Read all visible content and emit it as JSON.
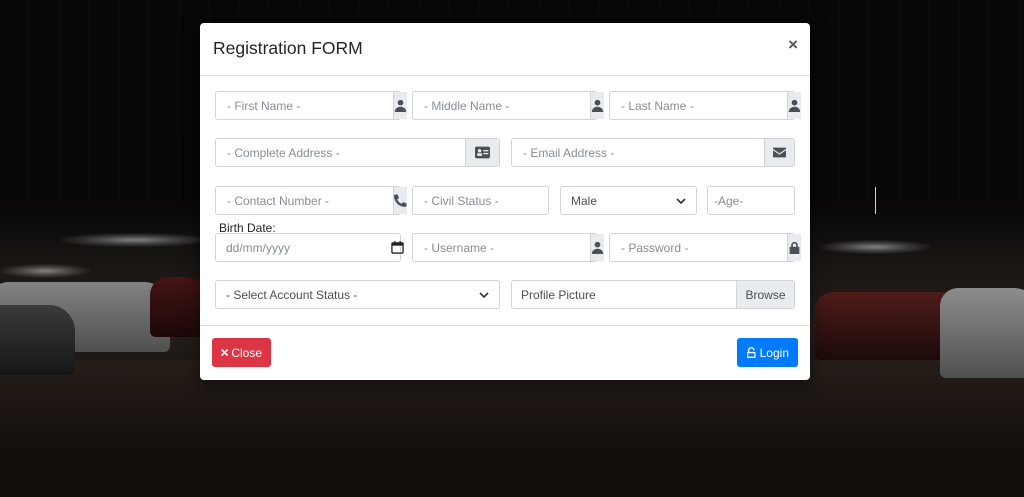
{
  "modal": {
    "title": "Registration FORM",
    "close_symbol": "×"
  },
  "fields": {
    "first_name": {
      "placeholder": "- First Name -",
      "icon": "user-icon"
    },
    "middle_name": {
      "placeholder": "- Middle Name -",
      "icon": "user-icon"
    },
    "last_name": {
      "placeholder": "- Last Name -",
      "icon": "user-icon"
    },
    "address": {
      "placeholder": "- Complete Address -",
      "icon": "address-card-icon"
    },
    "email": {
      "placeholder": "- Email Address -",
      "icon": "envelope-icon"
    },
    "contact": {
      "placeholder": "- Contact Number -",
      "icon": "phone-icon"
    },
    "civil_status": {
      "placeholder": "- Civil Status -",
      "icon": "heart-icon"
    },
    "gender": {
      "value": "Male"
    },
    "age": {
      "placeholder": "-Age-"
    },
    "birth_label": "Birth Date:",
    "birth_date": {
      "placeholder": "dd/mm/yyyy",
      "icon": "calendar-icon"
    },
    "username": {
      "placeholder": "- Username -",
      "icon": "user-icon"
    },
    "password": {
      "placeholder": "- Password -",
      "icon": "lock-icon"
    },
    "account_status": {
      "value": "- Select Account Status -"
    },
    "profile_picture": {
      "label": "Profile Picture",
      "browse_label": "Browse"
    }
  },
  "footer": {
    "close_label": "Close",
    "close_icon": "times-icon",
    "login_label": "Login",
    "login_icon": "unlock-icon"
  },
  "colors": {
    "danger": "#dc3545",
    "primary": "#007bff",
    "addon_bg": "#e9ecef",
    "border": "#ced4da"
  }
}
